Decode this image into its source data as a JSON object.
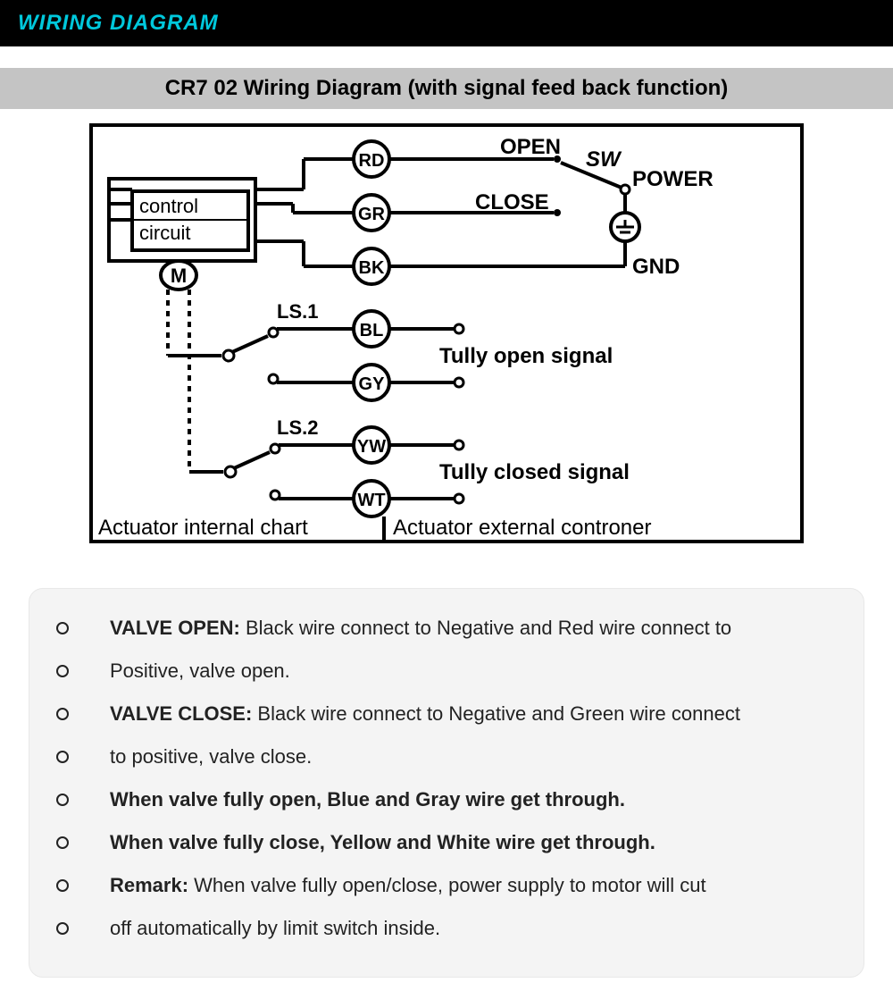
{
  "header": {
    "title": "WIRING DIAGRAM"
  },
  "subheader": {
    "title": "CR7 02 Wiring Diagram (with signal feed back function)"
  },
  "diagram": {
    "box_label": "control circuit",
    "motor": "M",
    "ls1": "LS.1",
    "ls2": "LS.2",
    "internal_label": "Actuator internal chart",
    "external_label": "Actuator external controner",
    "wires": {
      "rd": "RD",
      "gr": "GR",
      "bk": "BK",
      "bl": "BL",
      "gy": "GY",
      "yw": "YW",
      "wt": "WT"
    },
    "ext": {
      "open": "OPEN",
      "sw": "SW",
      "power": "POWER",
      "close": "CLOSE",
      "gnd": "GND",
      "open_signal": "Tully open signal",
      "closed_signal": "Tully closed signal"
    }
  },
  "notes": {
    "lines": [
      {
        "b": "VALVE OPEN: ",
        "t": "Black wire connect to Negative and Red wire connect to"
      },
      {
        "b": "",
        "t": "Positive, valve open."
      },
      {
        "b": "VALVE CLOSE: ",
        "t": "Black wire connect to Negative and Green wire connect"
      },
      {
        "b": "",
        "t": "to positive, valve close."
      },
      {
        "b": "When valve fully open, Blue and Gray wire get through.",
        "t": ""
      },
      {
        "b": "When valve fully close, Yellow and White wire get through.",
        "t": ""
      },
      {
        "b": "Remark: ",
        "t": "When valve fully open/close, power supply to motor will cut"
      },
      {
        "b": "",
        "t": "off automatically by limit switch inside."
      }
    ]
  }
}
